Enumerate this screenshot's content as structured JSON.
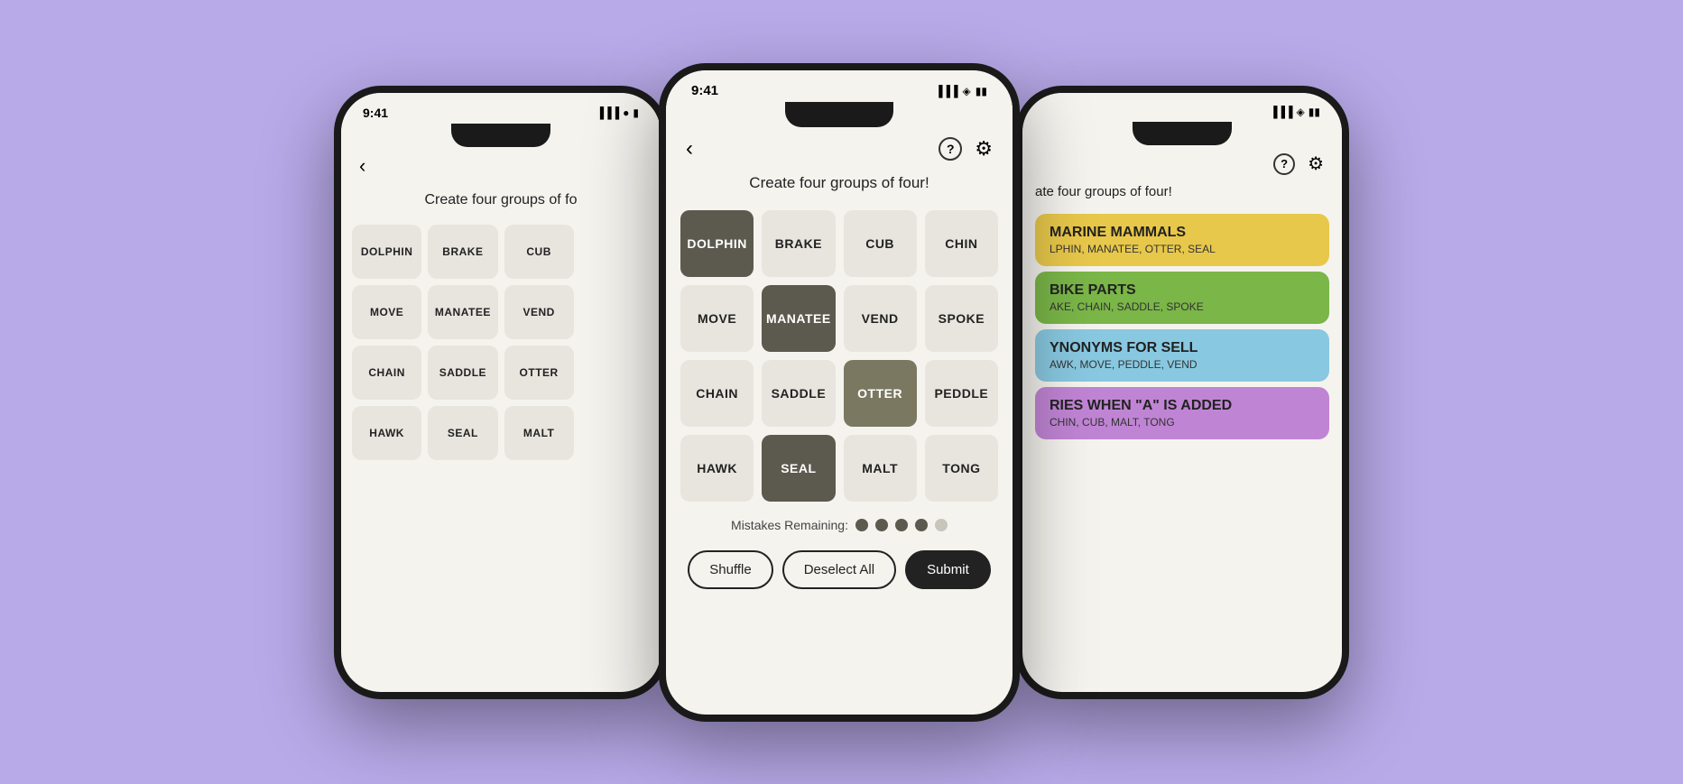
{
  "background": "#b8a9e8",
  "phones": {
    "left": {
      "time": "9:41",
      "title": "Create four groups of fo",
      "grid": [
        [
          "DOLPHIN",
          "BRAKE",
          "CUB",
          ""
        ],
        [
          "MOVE",
          "MANATEE",
          "VEND",
          ""
        ],
        [
          "CHAIN",
          "SADDLE",
          "OTTER",
          ""
        ],
        [
          "HAWK",
          "SEAL",
          "MALT",
          ""
        ]
      ]
    },
    "center": {
      "time": "9:41",
      "subtitle": "Create four groups of four!",
      "grid": [
        [
          {
            "label": "DOLPHIN",
            "state": "selected-dark"
          },
          {
            "label": "BRAKE",
            "state": "normal"
          },
          {
            "label": "CUB",
            "state": "normal"
          },
          {
            "label": "CHIN",
            "state": "normal"
          }
        ],
        [
          {
            "label": "MOVE",
            "state": "normal"
          },
          {
            "label": "MANATEE",
            "state": "selected-dark"
          },
          {
            "label": "VEND",
            "state": "normal"
          },
          {
            "label": "SPOKE",
            "state": "normal"
          }
        ],
        [
          {
            "label": "CHAIN",
            "state": "normal"
          },
          {
            "label": "SADDLE",
            "state": "normal"
          },
          {
            "label": "OTTER",
            "state": "selected-medium"
          },
          {
            "label": "PEDDLE",
            "state": "normal"
          }
        ],
        [
          {
            "label": "HAWK",
            "state": "normal"
          },
          {
            "label": "SEAL",
            "state": "selected-dark"
          },
          {
            "label": "MALT",
            "state": "normal"
          },
          {
            "label": "TONG",
            "state": "normal"
          }
        ]
      ],
      "mistakes_label": "Mistakes Remaining:",
      "dots": [
        "filled",
        "filled",
        "filled",
        "filled",
        "empty"
      ],
      "buttons": {
        "shuffle": "Shuffle",
        "deselect": "Deselect All",
        "submit": "Submit"
      }
    },
    "right": {
      "subtitle": "ate four groups of four!",
      "categories": [
        {
          "title": "MARINE MAMMALS",
          "words": "LPHIN, MANATEE, OTTER, SEAL",
          "color": "result-yellow"
        },
        {
          "title": "BIKE PARTS",
          "words": "AKE, CHAIN, SADDLE, SPOKE",
          "color": "result-green"
        },
        {
          "title": "YNONYMS FOR SELL",
          "words": "AWK, MOVE, PEDDLE, VEND",
          "color": "result-blue"
        },
        {
          "title": "RIES WHEN \"A\" IS ADDED",
          "words": "CHIN, CUB, MALT, TONG",
          "color": "result-purple"
        }
      ]
    }
  }
}
